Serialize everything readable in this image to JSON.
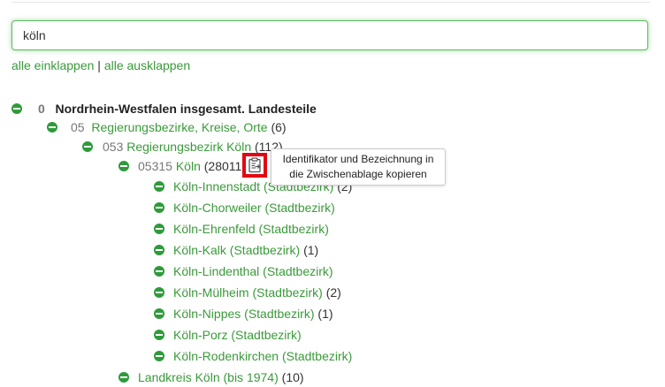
{
  "search": {
    "value": "köln"
  },
  "controls": {
    "collapse_all": "alle einklappen",
    "separator": "|",
    "expand_all": "alle ausklappen"
  },
  "tree": {
    "root": {
      "code": "0",
      "label": "Nordrhein-Westfalen insgesamt. Landesteile"
    },
    "level1": {
      "code": "05",
      "label": "Regierungsbezirke, Kreise, Orte",
      "count": "(6)"
    },
    "level2": {
      "code": "053",
      "label": "Regierungsbezirk Köln",
      "count": "(112)"
    },
    "level3": {
      "code": "05315",
      "label": "Köln",
      "count": "(28011"
    },
    "districts": [
      {
        "label": "Köln-Innenstadt (Stadtbezirk)",
        "count": "(2)"
      },
      {
        "label": "Köln-Chorweiler (Stadtbezirk)",
        "count": ""
      },
      {
        "label": "Köln-Ehrenfeld (Stadtbezirk)",
        "count": ""
      },
      {
        "label": "Köln-Kalk (Stadtbezirk)",
        "count": "(1)"
      },
      {
        "label": "Köln-Lindenthal (Stadtbezirk)",
        "count": ""
      },
      {
        "label": "Köln-Mülheim (Stadtbezirk)",
        "count": "(2)"
      },
      {
        "label": "Köln-Nippes (Stadtbezirk)",
        "count": "(1)"
      },
      {
        "label": "Köln-Porz (Stadtbezirk)",
        "count": ""
      },
      {
        "label": "Köln-Rodenkirchen (Stadtbezirk)",
        "count": ""
      }
    ],
    "sibling": {
      "label": "Landkreis Köln (bis 1974)",
      "count": "(10)"
    }
  },
  "tooltip": {
    "line1": "Identifikator und Bezeichnung in",
    "line2": "die Zwischenablage kopieren"
  },
  "icons": {
    "copy": "clipboard-copy-icon",
    "toggle": "minus-circle-icon"
  },
  "colors": {
    "link": "#3a9a3a",
    "toggle": "#2e9b3b",
    "focus_border": "#5cb85c",
    "highlight_frame": "#e30613"
  }
}
